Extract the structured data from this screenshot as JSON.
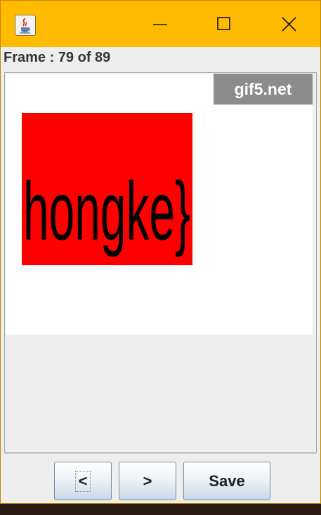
{
  "window": {
    "app_icon": "java-cup-icon",
    "controls": {
      "minimize_icon": "minimize-icon",
      "maximize_icon": "maximize-icon",
      "close_icon": "close-icon"
    },
    "title_bar_color": "#ffbb00"
  },
  "frame_info": {
    "label": "Frame : 79 of 89",
    "current": 79,
    "total": 89
  },
  "preview": {
    "watermark": "gif5.net",
    "frame_text": "hongke}",
    "frame_background": "#ff0000"
  },
  "buttons": {
    "prev_label": "<",
    "next_label": ">",
    "save_label": "Save"
  }
}
